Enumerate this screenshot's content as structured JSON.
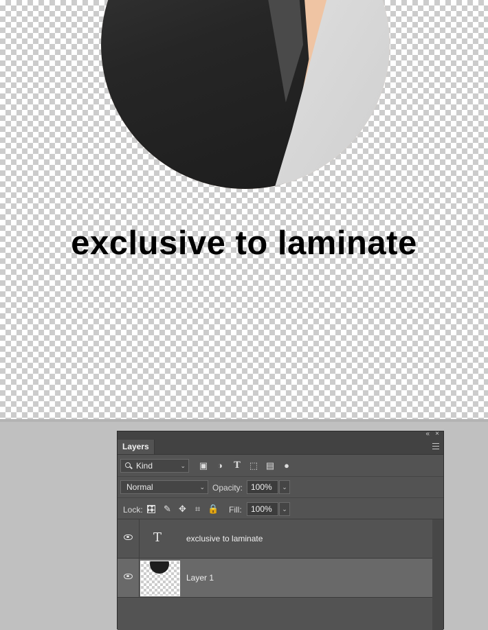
{
  "canvas": {
    "text": "exclusive to laminate"
  },
  "panel": {
    "tab": "Layers",
    "collapse_glyph": "«",
    "close_glyph": "×",
    "filter": {
      "kind_label": "Kind"
    },
    "blend": {
      "mode": "Normal",
      "opacity_label": "Opacity:",
      "opacity_value": "100%"
    },
    "lock": {
      "label": "Lock:",
      "fill_label": "Fill:",
      "fill_value": "100%"
    },
    "layers": [
      {
        "name": "exclusive to laminate",
        "type": "text",
        "visible": true,
        "icon": "T"
      },
      {
        "name": "Layer 1",
        "type": "pixel",
        "visible": true,
        "selected": true
      }
    ]
  },
  "icons": {
    "pixel": "▣",
    "adjust": "◑",
    "type": "T",
    "shape": "⬚",
    "smart": "▤",
    "toggle": "●",
    "paint": "✎",
    "move": "✥",
    "artboard": "⌗",
    "lock": "🔒",
    "caret": "⌄"
  }
}
